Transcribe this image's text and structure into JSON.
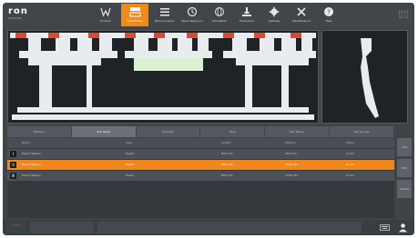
{
  "brand": {
    "name": "ron",
    "tagline": "CAD/CAM"
  },
  "clock": {
    "time": "10:21",
    "date": "18.11"
  },
  "nav": [
    {
      "label": "Product",
      "icon": "w-icon",
      "active": false
    },
    {
      "label": "Tools/Setup",
      "icon": "tools-setup-icon",
      "active": true
    },
    {
      "label": "Bend program",
      "icon": "list-icon",
      "active": false
    },
    {
      "label": "Bend sequence",
      "icon": "sequence-icon",
      "active": false
    },
    {
      "label": "Simulation",
      "icon": "globe-icon",
      "active": false
    },
    {
      "label": "Production",
      "icon": "press-icon",
      "active": false
    },
    {
      "label": "Settings",
      "icon": "gear-icon",
      "active": false
    },
    {
      "label": "Maintenance",
      "icon": "wrench-icon",
      "active": false
    },
    {
      "label": "Help",
      "icon": "help-icon",
      "active": false
    }
  ],
  "tabs": [
    "Stations",
    "Tool setup",
    "Punches",
    "Dies",
    "Tool library",
    "Tool groups"
  ],
  "table": {
    "headers": [
      "Name",
      "Type",
      "Length",
      "Position",
      "Offset"
    ],
    "rows": [
      {
        "icon": "I",
        "cells": [
          "Punch Station",
          "Punch",
          "835 mm",
          "250 mm",
          "0 mm"
        ],
        "selected": false
      },
      {
        "icon": "II",
        "cells": [
          "Punch Station",
          "Punch",
          "835 mm",
          "1000 mm",
          "0 mm"
        ],
        "selected": true
      },
      {
        "icon": "III",
        "cells": [
          "Punch Station",
          "Punch",
          "835 mm",
          "1750 mm",
          "0 mm"
        ],
        "selected": false
      }
    ]
  },
  "side_buttons": [
    "Add",
    "Edit",
    "Delete"
  ],
  "bottom": {
    "stop_label": "STOP"
  }
}
